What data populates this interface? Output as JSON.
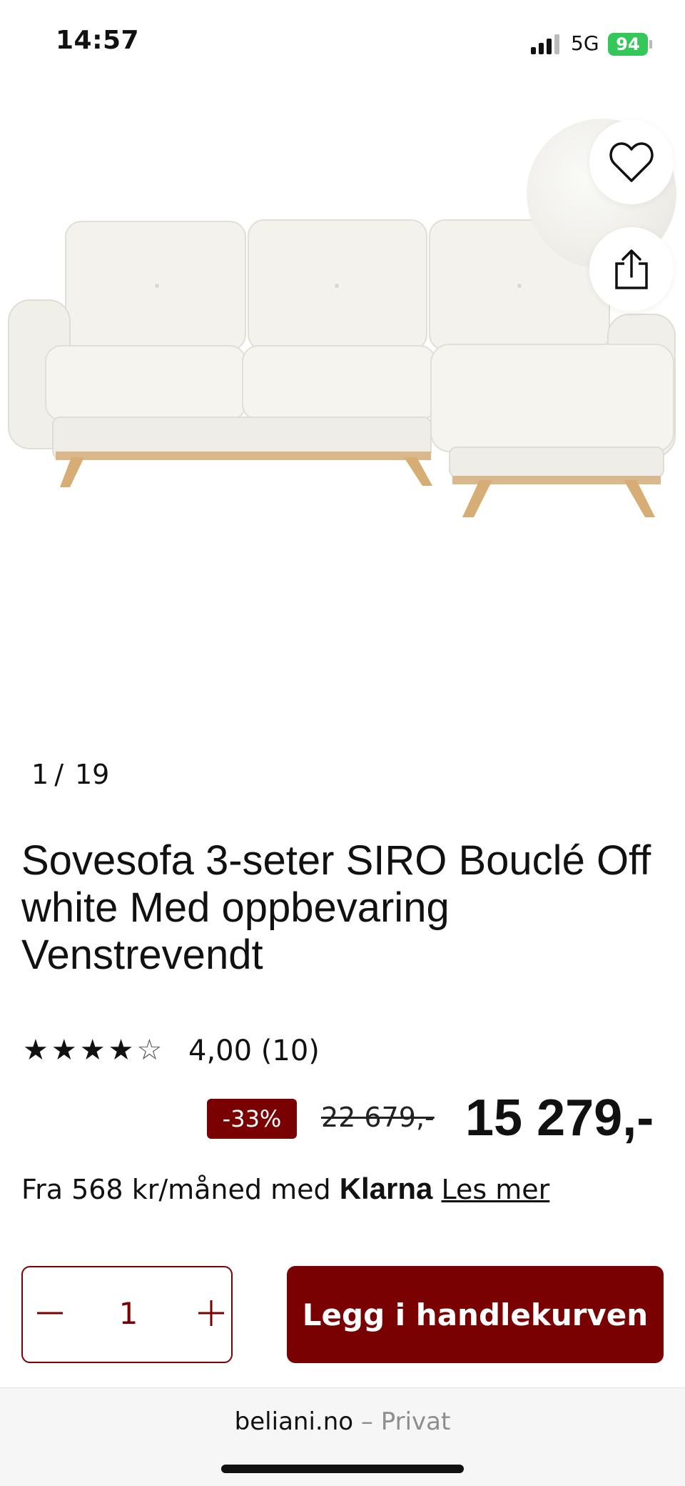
{
  "status_bar": {
    "time": "14:57",
    "network": "5G",
    "battery": "94"
  },
  "gallery": {
    "index": "1",
    "separator": "/",
    "total": "19"
  },
  "product": {
    "title": "Sovesofa 3-seter SIRO Bouclé Off white Med oppbevaring Venstrevendt",
    "rating_stars": 4,
    "rating_max": 5,
    "rating_text": "4,00 (10)",
    "discount": "-33%",
    "old_price": "22 679,-",
    "price": "15 279,-"
  },
  "financing": {
    "prefix": "Fra 568 kr/måned med",
    "provider": "Klarna",
    "link": "Les mer"
  },
  "cart": {
    "quantity": "1",
    "add_label": "Legg i handlekurven"
  },
  "browser": {
    "domain": "beliani.no",
    "separator": "–",
    "mode": "Privat"
  },
  "colors": {
    "brand": "#7a0102",
    "battery": "#34c759"
  },
  "icons": [
    "heart-icon",
    "share-icon",
    "minus-icon",
    "plus-icon",
    "star-icon"
  ]
}
